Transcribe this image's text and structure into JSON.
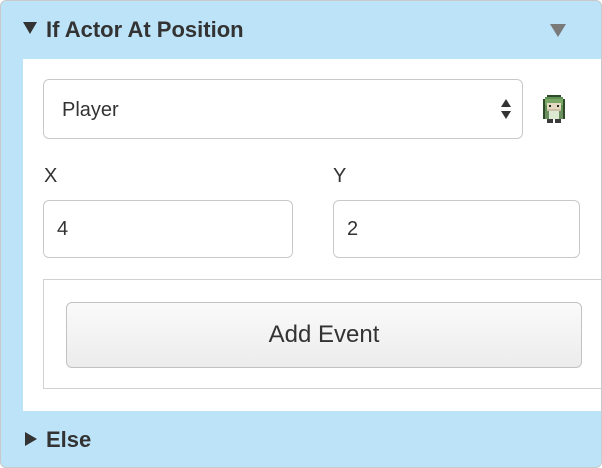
{
  "block": {
    "title": "If Actor At Position",
    "header_icon": "caret-down-icon",
    "menu_icon": "caret-down-icon"
  },
  "actor": {
    "selected": "Player",
    "sprite_icon": "actor-sprite-icon"
  },
  "position": {
    "x_label": "X",
    "x_value": "4",
    "y_label": "Y",
    "y_value": "2"
  },
  "events": {
    "add_label": "Add Event"
  },
  "else": {
    "label": "Else",
    "icon": "caret-right-icon"
  },
  "colors": {
    "header_background": "#bde3f8",
    "body_background": "#ffffff",
    "border": "#c9c9c9",
    "text": "#333333"
  }
}
